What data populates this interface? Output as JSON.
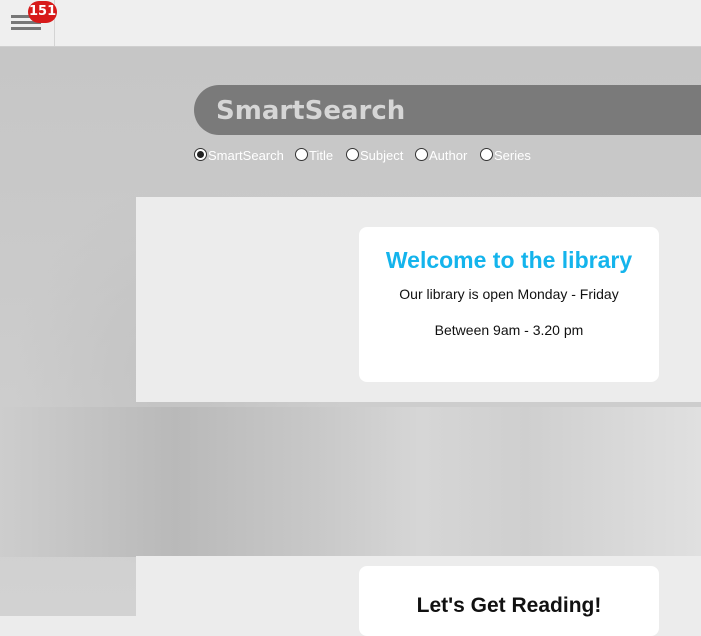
{
  "topbar": {
    "menu_icon": "hamburger-icon",
    "notification_count": "151"
  },
  "search": {
    "placeholder": "SmartSearch",
    "options": [
      {
        "label": "SmartSearch",
        "checked": true
      },
      {
        "label": "Title",
        "checked": false
      },
      {
        "label": "Subject",
        "checked": false
      },
      {
        "label": "Author",
        "checked": false
      },
      {
        "label": "Series",
        "checked": false
      }
    ]
  },
  "welcome": {
    "title": "Welcome to the library",
    "line1": "Our library is open Monday - Friday",
    "line2": "Between 9am - 3.20 pm"
  },
  "reading": {
    "title": "Let's Get Reading!"
  },
  "colors": {
    "title_accent": "#14b4ec",
    "badge": "#d71a1a"
  }
}
